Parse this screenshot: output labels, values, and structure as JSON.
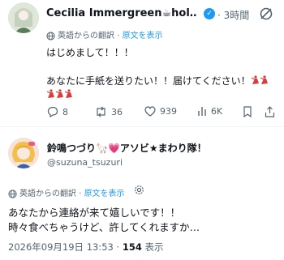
{
  "tweet1": {
    "author_name": "Cecilia Immergreen☕hol…",
    "time": "3時間",
    "translation_label": "英語からの翻訳",
    "show_original": "原文を表示",
    "line1": "はじめまして！！！",
    "line2": "あなたに手紙を送りたい！！届けてください！",
    "replies": "8",
    "reposts": "36",
    "likes": "939",
    "views": "6K"
  },
  "tweet2": {
    "author_name": "鈴鳴つづり🦙💗アソビ★まわり隊！",
    "handle": "@suzuna_tsuzuri",
    "translation_label": "英語からの翻訳",
    "show_original": "原文を表示",
    "line1": "あなたから連絡が来て嬉しいです！！",
    "line2": "時々食べちゃうけど、許してくれますか…",
    "timestamp": "2026年09月19日 13:53",
    "separator": "·",
    "views": "154",
    "views_label": "表示"
  },
  "colors": {
    "accent": "#1d9bf0",
    "secondary_text": "#536471",
    "dancer": "#d93c3c"
  }
}
